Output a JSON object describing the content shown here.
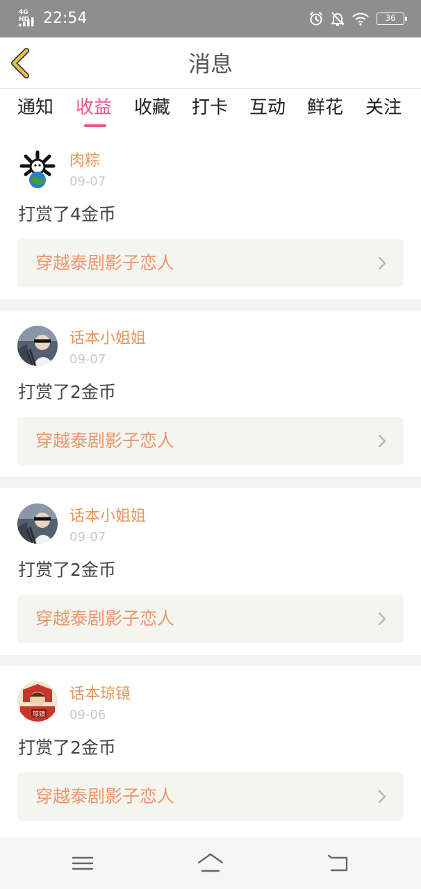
{
  "status_bar": {
    "network": "4G HD",
    "time": "22:54",
    "battery": "36",
    "icons": [
      "signal-icon",
      "alarm-icon",
      "mute-bell-icon",
      "wifi-icon",
      "battery-icon"
    ]
  },
  "header": {
    "title": "消息",
    "back_icon": "back-chevron-icon",
    "accent_color": "#e8b84a"
  },
  "tabs": [
    {
      "label": "通知",
      "active": false
    },
    {
      "label": "收益",
      "active": true
    },
    {
      "label": "收藏",
      "active": false
    },
    {
      "label": "打卡",
      "active": false
    },
    {
      "label": "互动",
      "active": false
    },
    {
      "label": "鲜花",
      "active": false
    },
    {
      "label": "关注",
      "active": false
    }
  ],
  "colors": {
    "active_tab": "#e8588c",
    "username": "#e8955c",
    "story_link": "#ec956a",
    "date": "#c9c9c9"
  },
  "messages": [
    {
      "user": "肉粽",
      "date": "09-07",
      "action": "打赏了4金币",
      "story": "穿越泰剧影子恋人",
      "avatar": "avatar-skull-globe"
    },
    {
      "user": "话本小姐姐",
      "date": "09-07",
      "action": "打赏了2金币",
      "story": "穿越泰剧影子恋人",
      "avatar": "avatar-sunglasses"
    },
    {
      "user": "话本小姐姐",
      "date": "09-07",
      "action": "打赏了2金币",
      "story": "穿越泰剧影子恋人",
      "avatar": "avatar-sunglasses"
    },
    {
      "user": "话本琼镜",
      "date": "09-06",
      "action": "打赏了2金币",
      "story": "穿越泰剧影子恋人",
      "avatar": "avatar-badge"
    }
  ],
  "avatar_badge_text": "琼镜",
  "nav": [
    "menu-icon",
    "home-icon",
    "back-icon"
  ]
}
